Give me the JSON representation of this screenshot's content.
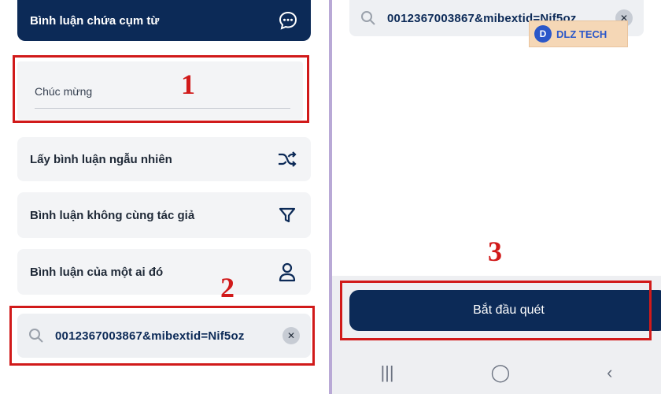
{
  "left": {
    "top_button": {
      "label": "Bình luận chứa cụm từ",
      "icon": "chat-bubble-icon"
    },
    "input": {
      "value": "Chúc mừng"
    },
    "options": [
      {
        "label": "Lấy bình luận ngẫu nhiên",
        "icon": "shuffle-icon"
      },
      {
        "label": "Bình luận không cùng tác giả",
        "icon": "filter-icon"
      },
      {
        "label": "Bình luận của một ai đó",
        "icon": "user-icon"
      }
    ],
    "search": {
      "value": "0012367003867&mibextid=Nif5oz",
      "clear": "✕"
    }
  },
  "right": {
    "search": {
      "value": "0012367003867&mibextid=Nif5oz",
      "clear": "✕"
    },
    "logo": {
      "letter": "D",
      "text": "DLZ TECH"
    },
    "start_button": {
      "label": "Bắt đầu quét"
    },
    "navbar": {
      "recents": "|||",
      "home": "◯",
      "back": "‹"
    }
  },
  "annotations": {
    "one": "1",
    "two": "2",
    "three": "3"
  },
  "colors": {
    "accent": "#0c2a57",
    "highlight": "#d11a1a"
  }
}
